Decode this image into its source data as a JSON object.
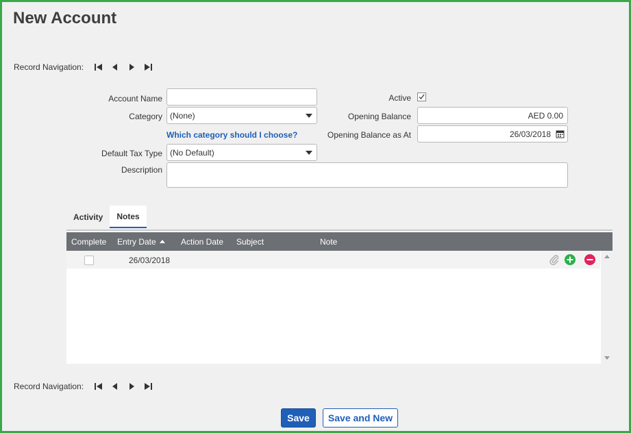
{
  "page": {
    "title": "New Account"
  },
  "record_navigation": {
    "label": "Record Navigation:",
    "icons": [
      "first-record-icon",
      "previous-record-icon",
      "next-record-icon",
      "last-record-icon"
    ]
  },
  "form": {
    "account_name": {
      "label": "Account Name",
      "value": ""
    },
    "category": {
      "label": "Category",
      "value": "(None)"
    },
    "category_help_link": "Which category should I choose?",
    "default_tax_type": {
      "label": "Default Tax Type",
      "value": "(No Default)"
    },
    "description": {
      "label": "Description",
      "value": ""
    },
    "active": {
      "label": "Active",
      "checked": true
    },
    "opening_balance": {
      "label": "Opening Balance",
      "value": "AED 0.00"
    },
    "opening_balance_as_at": {
      "label": "Opening Balance as At",
      "value": "26/03/2018"
    }
  },
  "tabs": [
    {
      "label": "Activity",
      "active": false
    },
    {
      "label": "Notes",
      "active": true
    }
  ],
  "notes_grid": {
    "columns": [
      "Complete",
      "Entry Date",
      "Action Date",
      "Subject",
      "Note"
    ],
    "sorted_column": "Entry Date",
    "sort_direction": "ascending",
    "rows": [
      {
        "complete": false,
        "entry_date": "26/03/2018",
        "action_date": "",
        "subject": "",
        "note": ""
      }
    ]
  },
  "buttons": {
    "save": "Save",
    "save_and_new": "Save and New"
  },
  "colors": {
    "frame_border": "#3aa84a",
    "primary": "#1f5fb8",
    "grid_header": "#6c6f73",
    "add_icon": "#2ab04a",
    "remove_icon": "#e0245e"
  }
}
